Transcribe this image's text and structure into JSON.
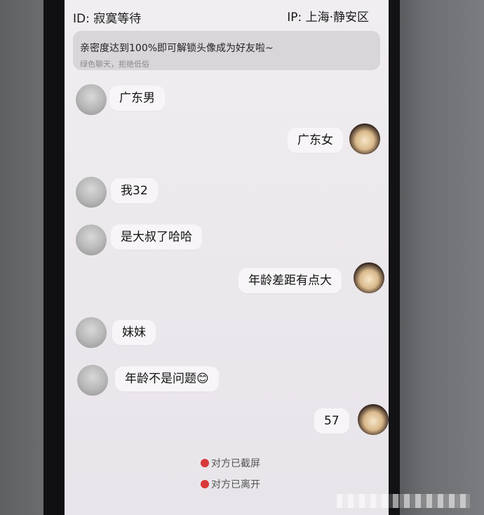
{
  "topbar": {
    "id_text": "ID: 寂寞等待",
    "ip_text": "IP: 上海·静安区"
  },
  "notice": {
    "main": "亲密度达到100%即可解锁头像成为好友啦~",
    "sub": "绿色聊天，拒绝低俗"
  },
  "messages": [
    {
      "side": "left",
      "text": "广东男"
    },
    {
      "side": "right",
      "text": "广东女"
    },
    {
      "side": "left",
      "text": "我32"
    },
    {
      "side": "left",
      "text": "是大叔了哈哈"
    },
    {
      "side": "right",
      "text": "年龄差距有点大"
    },
    {
      "side": "left",
      "text": "妹妹"
    },
    {
      "side": "left",
      "text": "年龄不是问题😊"
    },
    {
      "side": "right",
      "text": "57"
    }
  ],
  "system": [
    "对方已截屏",
    "对方已离开"
  ]
}
